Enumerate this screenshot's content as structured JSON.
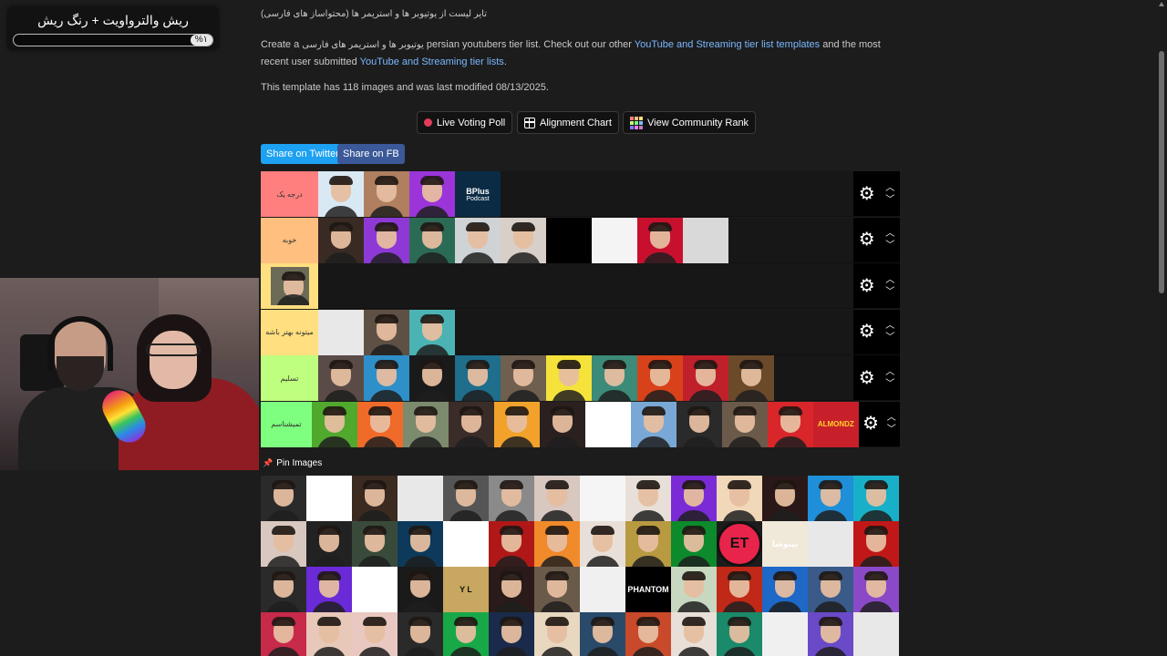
{
  "overlay": {
    "title": "ریش والترواویت + رنگ ریش",
    "progress_label": "%۱",
    "progress": 0.01
  },
  "header": {
    "crumb": "تایر لیست از یوتیوبر ها و استریمر ها (محتواساز های فارسی)",
    "desc_create": "Create a",
    "desc_fa": "یوتیوبر ها و استریمر های فارسی",
    "desc_mid": "persian youtubers tier list. Check out our other",
    "desc_link1": "YouTube and Streaming tier list templates",
    "desc_and": "and the most recent user submitted",
    "desc_link2": "YouTube and Streaming tier lists",
    "desc_end": ".",
    "modified": "This template has 118 images and was last modified 08/13/2025."
  },
  "toolbar": {
    "live_poll": "Live Voting Poll",
    "alignment": "Alignment Chart",
    "community": "View Community Rank",
    "twitter": "Share on Twitter",
    "fb": "Share on FB"
  },
  "colors": {
    "twitter": "#1da1f2",
    "fb": "#3b5998",
    "tier1": "#ff7f7f",
    "tier2": "#ffbf7f",
    "tier3": "#ffdf7f",
    "tier4": "#ffdf7f",
    "tier5": "#bfff7f",
    "tier6": "#7fff7f"
  },
  "tiers": [
    {
      "label": "درجه یک",
      "items": [
        "#d9e9f4",
        "#b07f5f",
        "#9b35d9",
        "#0b2b45"
      ],
      "bplus": {
        "line1": "BPlus",
        "line2": "Podcast"
      }
    },
    {
      "label": "خوبه",
      "items": [
        "#3a2a24",
        "#8e39d6",
        "#2b6b55",
        "#cfd3d6",
        "#d8cfc8",
        "#000000",
        "#f4f4f4",
        "#c8102e",
        "#d9d9d9"
      ]
    },
    {
      "label": "",
      "items": []
    },
    {
      "label": "میتونه بهتر باشه",
      "items": [
        "#e8e8e8",
        "#5e5044",
        "#4bb3b3"
      ]
    },
    {
      "label": "تسلیم",
      "items": [
        "#5b4b47",
        "#2f8fc8",
        "#1a1a1a",
        "#1e6e8c",
        "#6f5f4f",
        "#f5e23a",
        "#3c8a78",
        "#d8421a",
        "#c0202a",
        "#6b4a2a"
      ]
    },
    {
      "label": "تمیشناسم",
      "items": [
        "#50a82c",
        "#f06a2a",
        "#7c8a6e",
        "#3a2c28",
        "#f2a22a",
        "#2a2020",
        "#ffffff",
        "#7aa8d6",
        "#2a2a2a",
        "#6b5a4a",
        "#d8262a"
      ],
      "almondz": "ALMONDZ"
    }
  ],
  "pin": {
    "title": "Pin Images"
  },
  "pool_colors": [
    "#2a2a2a",
    "#ffffff",
    "#3b2a20",
    "#e8e8e8",
    "#555555",
    "#8a8a8a",
    "#d8c8c0",
    "#f5f5f5",
    "#e8e0d8",
    "#7a2bd6",
    "#f0d8b8",
    "#2a1818",
    "#1e8fd8",
    "#18b0c8",
    "#d8c8c0",
    "#222222",
    "#3a4a3a",
    "#0d3a5a",
    "#ffffff",
    "#b01818",
    "#f08a2a",
    "#e8e0d8",
    "#b89a40",
    "#0c8a2c",
    "#e8244a",
    "#f0e8d8",
    "#e8e8e8",
    "#c01818",
    "#2a2a2a",
    "#6a2ad8",
    "#ffffff",
    "#1a1a1a",
    "#c8a860",
    "#2a1a1a",
    "#6a5a4a",
    "#f0f0f0",
    "#000000",
    "#c8d8c0",
    "#c02818",
    "#1e68c8",
    "#3a5a8a",
    "#8a4ac8",
    "#c82a4a",
    "#e8c8b8",
    "#e8c8c0",
    "#2a2a2a",
    "#18a848",
    "#1a2a4a",
    "#e8d8c0",
    "#2a4a6a",
    "#c84a2a",
    "#e8e0d8",
    "#1a8a6a",
    "#f0f0f0",
    "#6a4ac8",
    "#e8e8e8"
  ],
  "pool_logos": {
    "phantom": "PHANTOM",
    "binosha": "بینوشا",
    "et": "ET",
    "yl": "Y L"
  }
}
